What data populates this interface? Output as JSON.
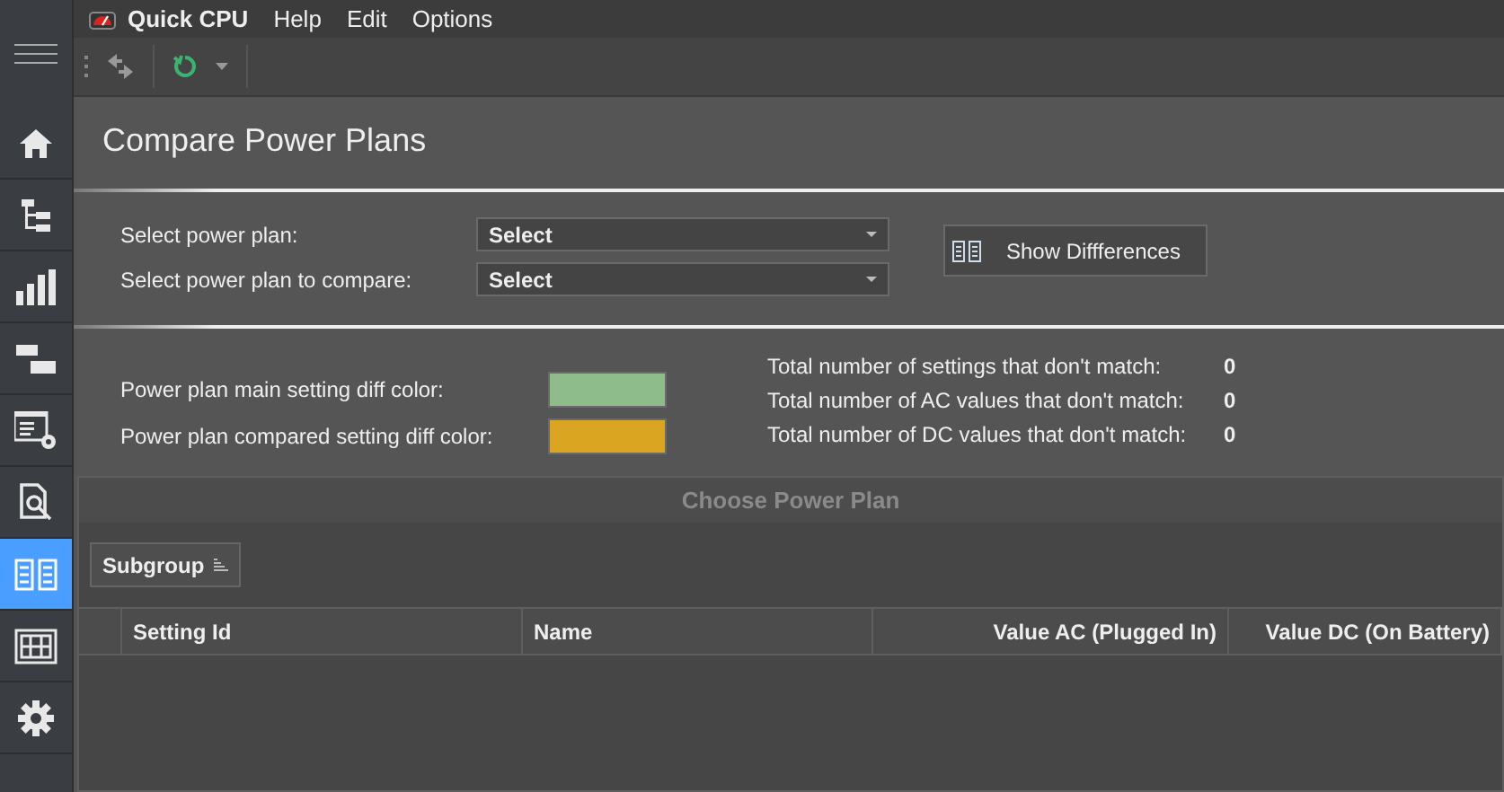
{
  "app": {
    "title": "Quick CPU",
    "menu": [
      "Help",
      "Edit",
      "Options"
    ]
  },
  "sidebar": {
    "items": [
      {
        "kind": "home",
        "selected": false
      },
      {
        "kind": "tree",
        "selected": false
      },
      {
        "kind": "chart",
        "selected": false
      },
      {
        "kind": "gantt",
        "selected": false
      },
      {
        "kind": "settings",
        "selected": false
      },
      {
        "kind": "inspect",
        "selected": false
      },
      {
        "kind": "compare",
        "selected": true
      },
      {
        "kind": "grid",
        "selected": false
      },
      {
        "kind": "gear",
        "selected": false
      }
    ]
  },
  "page": {
    "title": "Compare Power Plans",
    "selects": [
      {
        "label": "Select power plan:",
        "value": "Select"
      },
      {
        "label": "Select power plan to compare:",
        "value": "Select"
      }
    ],
    "button": "Show Diffferences",
    "legend": [
      {
        "label": "Power plan main setting diff color:",
        "color": "#8fbc8b"
      },
      {
        "label": "Power plan compared setting diff color:",
        "color": "#daa520"
      }
    ],
    "stats": [
      {
        "label": "Total number of settings that don't match:",
        "value": "0"
      },
      {
        "label": "Total number of AC values that don't match:",
        "value": "0"
      },
      {
        "label": "Total number of DC values that don't match:",
        "value": "0"
      }
    ],
    "grid": {
      "title": "Choose Power Plan",
      "group_by": "Subgroup",
      "columns": [
        "Setting Id",
        "Name",
        "Value AC (Plugged In)",
        "Value DC (On Battery)"
      ]
    }
  }
}
